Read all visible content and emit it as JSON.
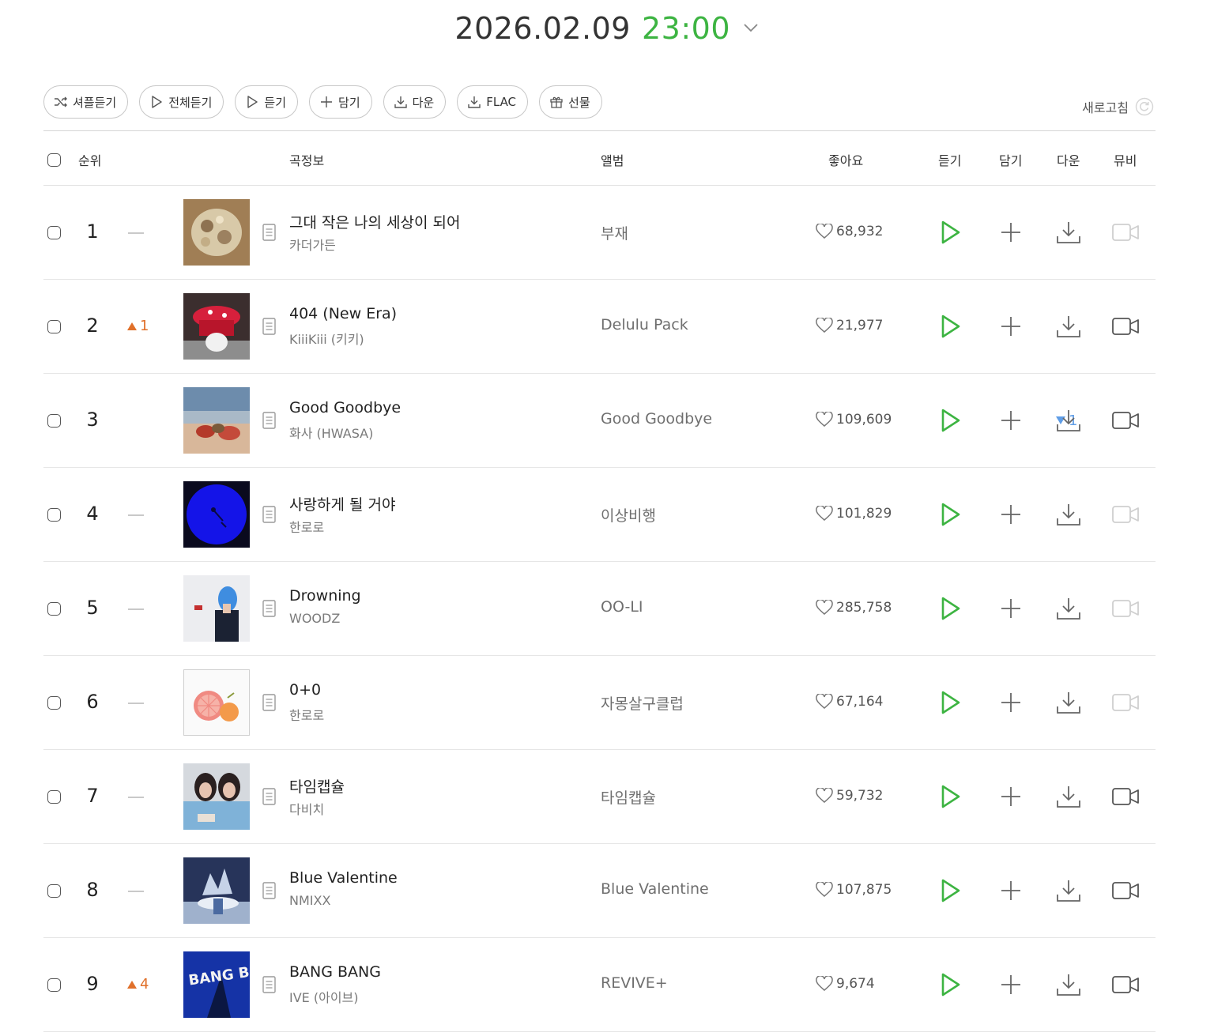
{
  "header": {
    "date": "2026.02.09",
    "time": "23:00"
  },
  "toolbar": {
    "shuffle": "셔플듣기",
    "play_all": "전체듣기",
    "play": "듣기",
    "add": "담기",
    "download": "다운",
    "flac": "FLAC",
    "gift": "선물",
    "refresh": "새로고침"
  },
  "columns": {
    "rank": "순위",
    "song_info": "곡정보",
    "album": "앨범",
    "likes": "좋아요",
    "listen": "듣기",
    "add": "담기",
    "download": "다운",
    "mv": "뮤비"
  },
  "colors": {
    "accent": "#3db442",
    "rank_up": "#e0702a",
    "rank_down": "#5f9de6"
  },
  "rows": [
    {
      "rank": "1",
      "change": "same",
      "change_value": "",
      "title": "그대 작은 나의 세상이 되어",
      "artist": "카더가든",
      "album": "부재",
      "likes": "68,932",
      "mv_available": false
    },
    {
      "rank": "2",
      "change": "up",
      "change_value": "1",
      "title": "404 (New Era)",
      "artist": "KiiiKiii (키키)",
      "album": "Delulu Pack",
      "likes": "21,977",
      "mv_available": true
    },
    {
      "rank": "3",
      "change": "down",
      "change_value": "1",
      "title": "Good Goodbye",
      "artist": "화사 (HWASA)",
      "album": "Good Goodbye",
      "likes": "109,609",
      "mv_available": true
    },
    {
      "rank": "4",
      "change": "same",
      "change_value": "",
      "title": "사랑하게 될 거야",
      "artist": "한로로",
      "album": "이상비행",
      "likes": "101,829",
      "mv_available": false
    },
    {
      "rank": "5",
      "change": "same",
      "change_value": "",
      "title": "Drowning",
      "artist": "WOODZ",
      "album": "OO-LI",
      "likes": "285,758",
      "mv_available": false
    },
    {
      "rank": "6",
      "change": "same",
      "change_value": "",
      "title": "0+0",
      "artist": "한로로",
      "album": "자몽살구클럽",
      "likes": "67,164",
      "mv_available": false
    },
    {
      "rank": "7",
      "change": "same",
      "change_value": "",
      "title": "타임캡슐",
      "artist": "다비치",
      "album": "타임캡슐",
      "likes": "59,732",
      "mv_available": true
    },
    {
      "rank": "8",
      "change": "same",
      "change_value": "",
      "title": "Blue Valentine",
      "artist": "NMIXX",
      "album": "Blue Valentine",
      "likes": "107,875",
      "mv_available": true
    },
    {
      "rank": "9",
      "change": "up",
      "change_value": "4",
      "title": "BANG BANG",
      "artist": "IVE (아이브)",
      "album": "REVIVE+",
      "likes": "9,674",
      "mv_available": true
    }
  ]
}
